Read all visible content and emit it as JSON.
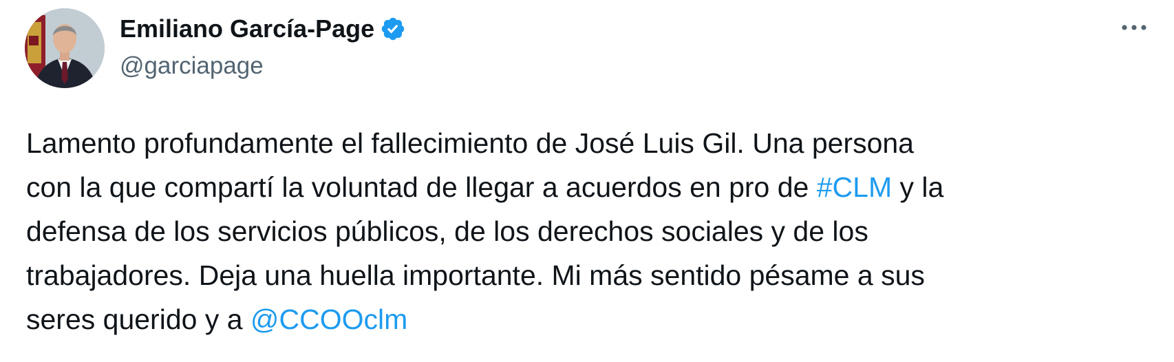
{
  "author": {
    "display_name": "Emiliano García-Page",
    "handle": "@garciapage",
    "verified": true
  },
  "tweet": {
    "lines": [
      {
        "before": "Lamento profundamente el fallecimiento de José Luis Gil. Una persona"
      },
      {
        "before": "con la que compartí la voluntad de llegar a acuerdos en pro de ",
        "hashtag": "#CLM",
        "after": " y la"
      },
      {
        "before": "defensa de los servicios públicos, de los derechos sociales y de los"
      },
      {
        "before": "trabajadores. Deja una huella importante. Mi más sentido pésame a sus"
      },
      {
        "before": "seres querido y a ",
        "mention": "@CCOOclm"
      }
    ]
  },
  "icons": {
    "verified": "verified-badge-icon",
    "more": "more-options-icon",
    "avatar": "profile-photo"
  },
  "colors": {
    "text": "#0f1419",
    "secondary": "#536471",
    "link": "#1d9bf0",
    "verified": "#1d9bf0"
  }
}
